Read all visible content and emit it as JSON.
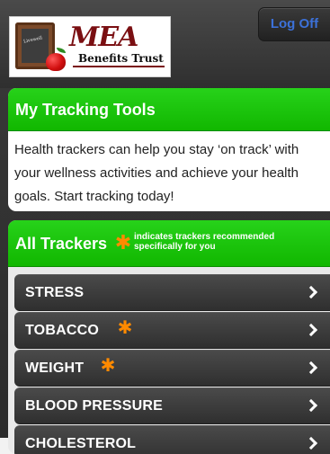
{
  "header": {
    "logo": {
      "brand": "MEA",
      "subbrand": "Benefits Trust",
      "board_text": "Livewell"
    },
    "logoff_label": "Log Off"
  },
  "tracking_tools": {
    "title": "My Tracking Tools",
    "description": "Health trackers can help you stay ‘on track’ with your wellness activities and achieve your health goals. Start tracking today!"
  },
  "all_trackers": {
    "title": "All Trackers",
    "legend_text": "indicates trackers recommended specifically for you",
    "legend_icon": "star-icon",
    "items": [
      {
        "label": "STRESS",
        "recommended": false
      },
      {
        "label": "TOBACCO",
        "recommended": true
      },
      {
        "label": "WEIGHT",
        "recommended": true
      },
      {
        "label": "BLOOD PRESSURE",
        "recommended": false
      },
      {
        "label": "CHOLESTEROL",
        "recommended": false
      }
    ]
  },
  "colors": {
    "green_header": "#11b700",
    "dark_bg": "#2b2b2b",
    "accent_blue": "#3c71d9",
    "star_orange": "#ff8a00"
  }
}
